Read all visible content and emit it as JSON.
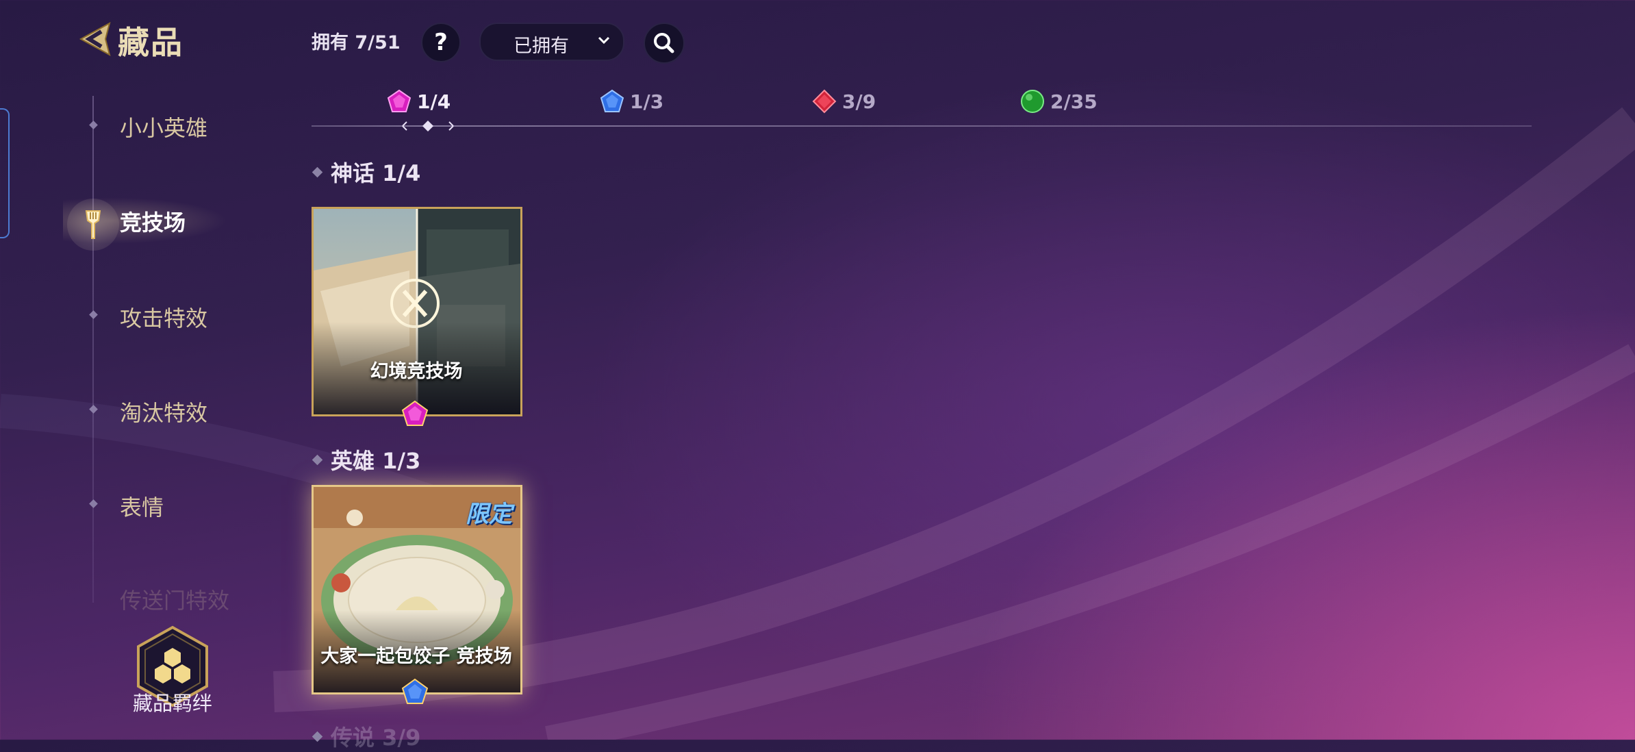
{
  "header": {
    "title": "藏品",
    "owned_count": "拥有 7/51",
    "help_label": "?",
    "filter": {
      "selected": "已拥有"
    }
  },
  "rarity_tabs": [
    {
      "count": "1/4",
      "color": "#d81fbf",
      "icon": "mythic-gem-icon",
      "active": true
    },
    {
      "count": "1/3",
      "color": "#2f6fe6",
      "icon": "hero-gem-icon"
    },
    {
      "count": "3/9",
      "color": "#d3243a",
      "icon": "legend-gem-icon"
    },
    {
      "count": "2/35",
      "color": "#1f9a2e",
      "icon": "common-gem-icon"
    }
  ],
  "sidebar": {
    "items": [
      {
        "label": "小小英雄"
      },
      {
        "label": "竞技场",
        "active": true
      },
      {
        "label": "攻击特效"
      },
      {
        "label": "淘汰特效"
      },
      {
        "label": "表情"
      },
      {
        "label": "传送门特效"
      }
    ],
    "bond_label": "藏品羁绊"
  },
  "sections": [
    {
      "title": "神话 1/4",
      "cards": [
        {
          "name": "幻境竞技场",
          "gem": "mythic"
        }
      ]
    },
    {
      "title": "英雄 1/3",
      "cards": [
        {
          "name": "大家一起包饺子 竞技场",
          "gem": "hero",
          "badge": "限定"
        }
      ]
    },
    {
      "title": "传说 3/9"
    }
  ],
  "colors": {
    "gold": "#c9a35a",
    "sidebar_text": "#d9c8a2",
    "accent_blue": "#4d7bd2"
  }
}
